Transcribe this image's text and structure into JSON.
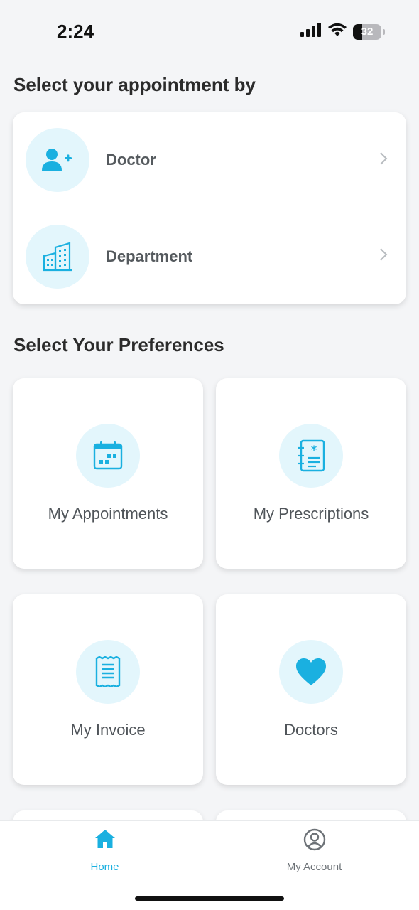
{
  "status_bar": {
    "time": "2:24",
    "battery_level": "32",
    "icons": [
      "signal-icon",
      "wifi-icon",
      "battery-icon"
    ]
  },
  "colors": {
    "accent": "#1ab0e0",
    "icon_bg": "#e3f6fc",
    "background": "#f4f5f7"
  },
  "appointment": {
    "title": "Select your appointment by",
    "options": [
      {
        "label": "Doctor",
        "icon": "add-user-icon"
      },
      {
        "label": "Department",
        "icon": "building-icon"
      }
    ]
  },
  "preferences": {
    "title": "Select Your Preferences",
    "tiles": [
      {
        "label": "My Appointments",
        "icon": "calendar-icon"
      },
      {
        "label": "My Prescriptions",
        "icon": "prescription-icon"
      },
      {
        "label": "My Invoice",
        "icon": "receipt-icon"
      },
      {
        "label": "Doctors",
        "icon": "heart-icon"
      }
    ]
  },
  "bottom_nav": {
    "items": [
      {
        "label": "Home",
        "icon": "home-icon",
        "active": true
      },
      {
        "label": "My Account",
        "icon": "account-icon",
        "active": false
      }
    ]
  }
}
